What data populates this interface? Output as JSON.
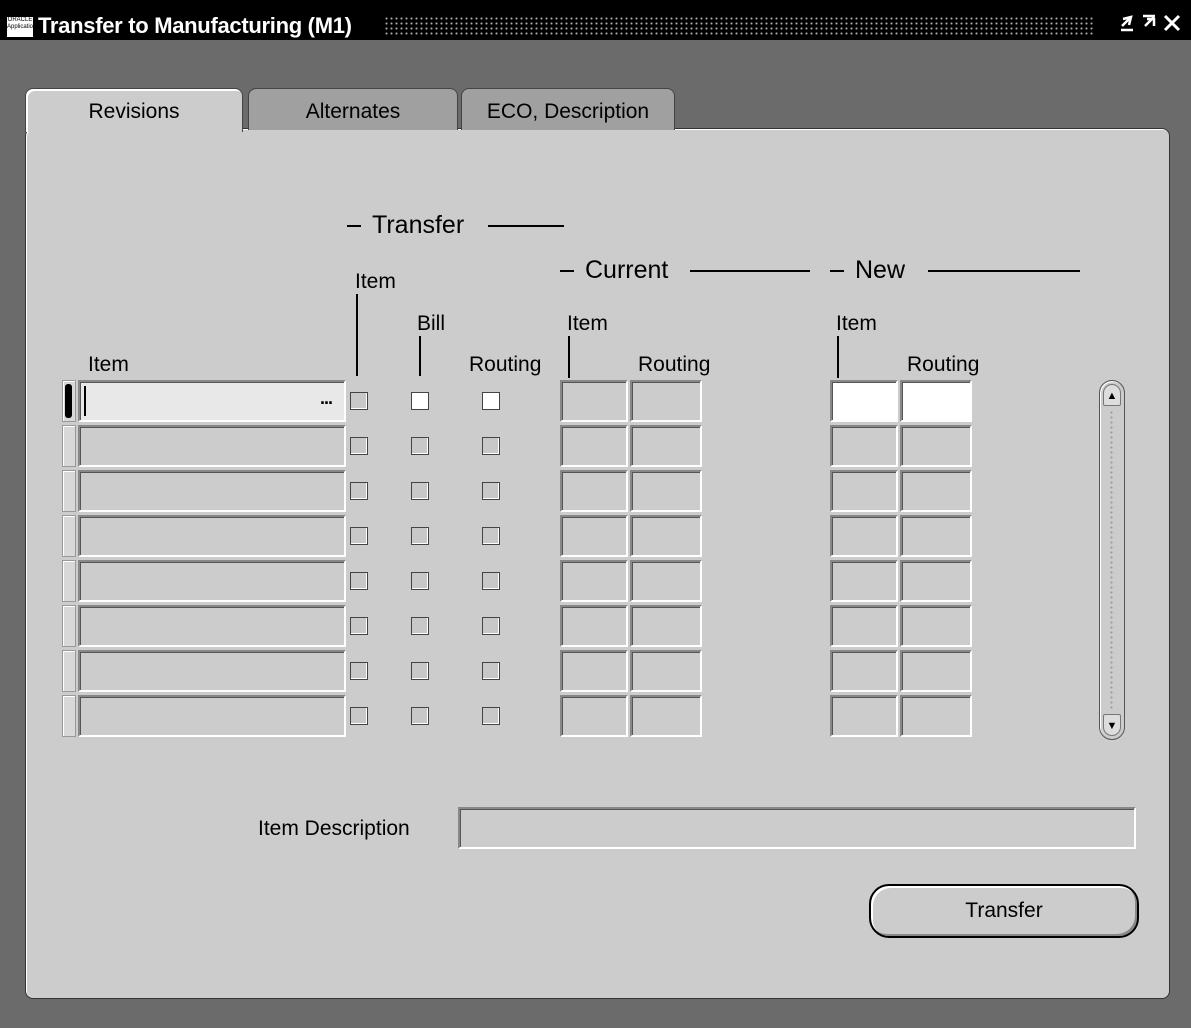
{
  "window": {
    "title": "Transfer to Manufacturing (M1)",
    "icon_text": "ORACLE Applications",
    "minimize": "⯆",
    "maximize": "⬈",
    "close": "✕"
  },
  "tabs": [
    {
      "label": "Revisions",
      "active": true
    },
    {
      "label": "Alternates",
      "active": false
    },
    {
      "label": "ECO, Description",
      "active": false
    }
  ],
  "headers": {
    "transfer_group": "Transfer",
    "current_group": "Current",
    "new_group": "New",
    "item": "Item",
    "transfer_item": "Item",
    "transfer_bill": "Bill",
    "transfer_routing": "Routing",
    "current_item": "Item",
    "current_routing": "Routing",
    "new_item": "Item",
    "new_routing": "Routing"
  },
  "rows": [
    {
      "item": "",
      "transfer_item": false,
      "transfer_bill": false,
      "transfer_routing": false,
      "current_item": "",
      "current_routing": "",
      "new_item": "",
      "new_routing": ""
    },
    {
      "item": "",
      "transfer_item": false,
      "transfer_bill": false,
      "transfer_routing": false,
      "current_item": "",
      "current_routing": "",
      "new_item": "",
      "new_routing": ""
    },
    {
      "item": "",
      "transfer_item": false,
      "transfer_bill": false,
      "transfer_routing": false,
      "current_item": "",
      "current_routing": "",
      "new_item": "",
      "new_routing": ""
    },
    {
      "item": "",
      "transfer_item": false,
      "transfer_bill": false,
      "transfer_routing": false,
      "current_item": "",
      "current_routing": "",
      "new_item": "",
      "new_routing": ""
    },
    {
      "item": "",
      "transfer_item": false,
      "transfer_bill": false,
      "transfer_routing": false,
      "current_item": "",
      "current_routing": "",
      "new_item": "",
      "new_routing": ""
    },
    {
      "item": "",
      "transfer_item": false,
      "transfer_bill": false,
      "transfer_routing": false,
      "current_item": "",
      "current_routing": "",
      "new_item": "",
      "new_routing": ""
    },
    {
      "item": "",
      "transfer_item": false,
      "transfer_bill": false,
      "transfer_routing": false,
      "current_item": "",
      "current_routing": "",
      "new_item": "",
      "new_routing": ""
    },
    {
      "item": "",
      "transfer_item": false,
      "transfer_bill": false,
      "transfer_routing": false,
      "current_item": "",
      "current_routing": "",
      "new_item": "",
      "new_routing": ""
    }
  ],
  "lov_button": "...",
  "item_description": {
    "label": "Item Description",
    "value": ""
  },
  "transfer_button": "Transfer",
  "scrollbar": {
    "up": "▲",
    "down": "▼"
  }
}
